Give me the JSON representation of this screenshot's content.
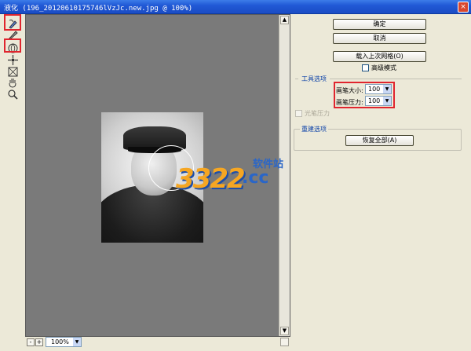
{
  "window": {
    "title": "液化 (196_20120610175746lVzJc.new.jpg @ 100%)",
    "close_glyph": "×"
  },
  "toolbar": {
    "icons": [
      "forward-warp-icon",
      "reconstruct-icon",
      "twirl-icon",
      "pucker-icon",
      "bloat-icon",
      "hand-icon",
      "zoom-icon"
    ]
  },
  "canvas": {
    "background": "#7a7a7a",
    "scroll_up": "▲",
    "scroll_down": "▼"
  },
  "watermark": {
    "number": "3322",
    "domain": ".cc",
    "site": "软件站"
  },
  "status": {
    "zoom_minus": "-",
    "zoom_plus": "+",
    "zoom_value": "100%",
    "dropdown_glyph": "▼"
  },
  "panel": {
    "ok_label": "确定",
    "cancel_label": "取消",
    "load_mesh_label": "载入上次网格(O)",
    "advanced_mode_label": "高级模式",
    "tool_options": {
      "title": "工具选项",
      "brush_size_label": "画笔大小:",
      "brush_size_value": "100",
      "brush_pressure_label": "画笔压力:",
      "brush_pressure_value": "100",
      "stylus_pressure_label": "光笔压力"
    },
    "reconstruct_options": {
      "title": "重建选项",
      "restore_all_label": "恢复全部(A)"
    }
  },
  "colors": {
    "titlebar": "#2159d6",
    "highlight_box": "#e0252e",
    "group_title": "#0b41a8"
  }
}
